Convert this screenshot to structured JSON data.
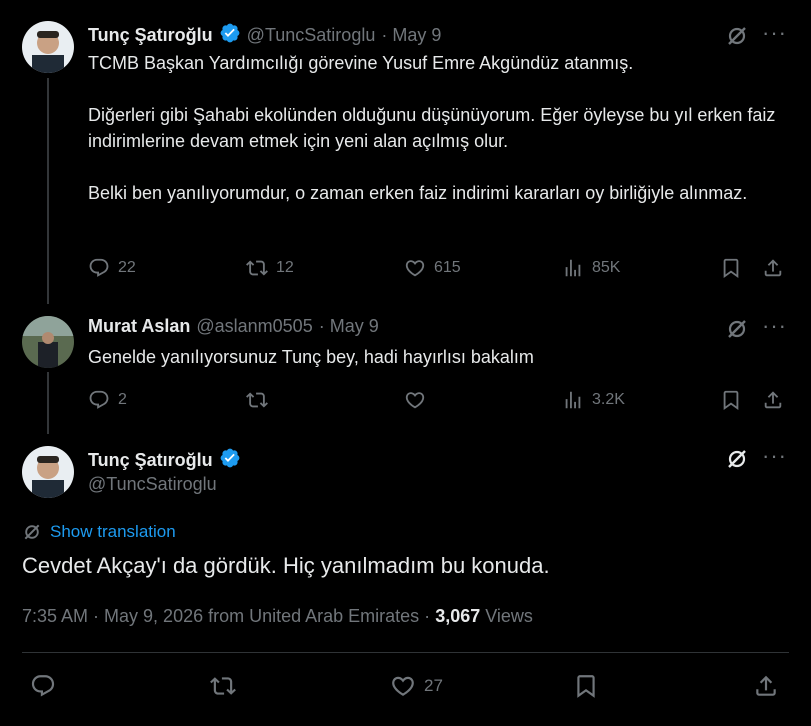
{
  "tweet1": {
    "name": "Tunç Şatıroğlu",
    "handle": "@TuncSatiroglu",
    "date": "· May 9",
    "text": "TCMB Başkan Yardımcılığı görevine Yusuf Emre Akgündüz atanmış.\n\nDiğerleri gibi Şahabi ekolünden olduğunu düşünüyorum. Eğer öyleyse bu yıl erken faiz indirimlerine devam etmek için yeni alan açılmış olur.\n\nBelki ben yanılıyorumdur, o zaman erken faiz indirimi kararları oy birliğiyle alınmaz.",
    "replies": "22",
    "reposts": "12",
    "likes": "615",
    "views": "85K"
  },
  "tweet2": {
    "name": "Murat Aslan",
    "handle": "@aslanm0505",
    "date": "· May 9",
    "text": "Genelde yanılıyorsunuz Tunç bey, hadi hayırlısı bakalım",
    "replies": "2",
    "views": "3.2K"
  },
  "main": {
    "name": "Tunç Şatıroğlu",
    "handle": "@TuncSatiroglu",
    "show_translation": "Show translation",
    "text": "Cevdet Akçay'ı da gördük. Hiç yanılmadım bu konuda.",
    "meta": "7:35 AM · May 9, 2026 from United Arab Emirates · ",
    "views_count": "3,067",
    "views_label": " Views",
    "likes": "27"
  },
  "icons": {
    "reply": "reply-icon",
    "repost": "repost-icon",
    "like": "heart-icon",
    "views": "views-icon",
    "bookmark": "bookmark-icon",
    "share": "share-icon",
    "grok": "grok-icon",
    "more": "more-icon",
    "verified": "verified-badge-icon",
    "translate": "translate-icon"
  },
  "colors": {
    "background": "#000000",
    "text": "#e7e9ea",
    "muted": "#71767b",
    "link": "#1d9bf0",
    "divider": "#2f3336"
  }
}
